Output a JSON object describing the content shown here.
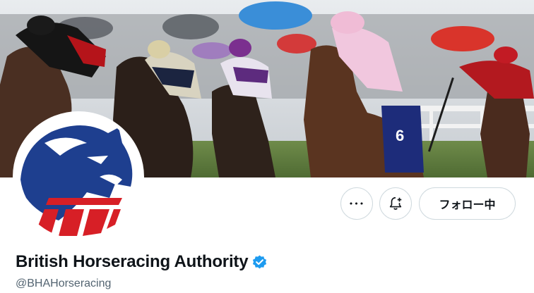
{
  "profile": {
    "display_name": "British Horseracing Authority",
    "handle": "@BHAHorseracing",
    "verified": true
  },
  "actions": {
    "more_label": "•••",
    "follow_label": "フォロー中"
  },
  "banner": {
    "description_icon": "banner-photo"
  },
  "colors": {
    "verified_blue": "#1d9bf0",
    "logo_blue": "#1e3f8f",
    "logo_red": "#d71f26",
    "border": "#cfd9de",
    "secondary_text": "#536471"
  }
}
